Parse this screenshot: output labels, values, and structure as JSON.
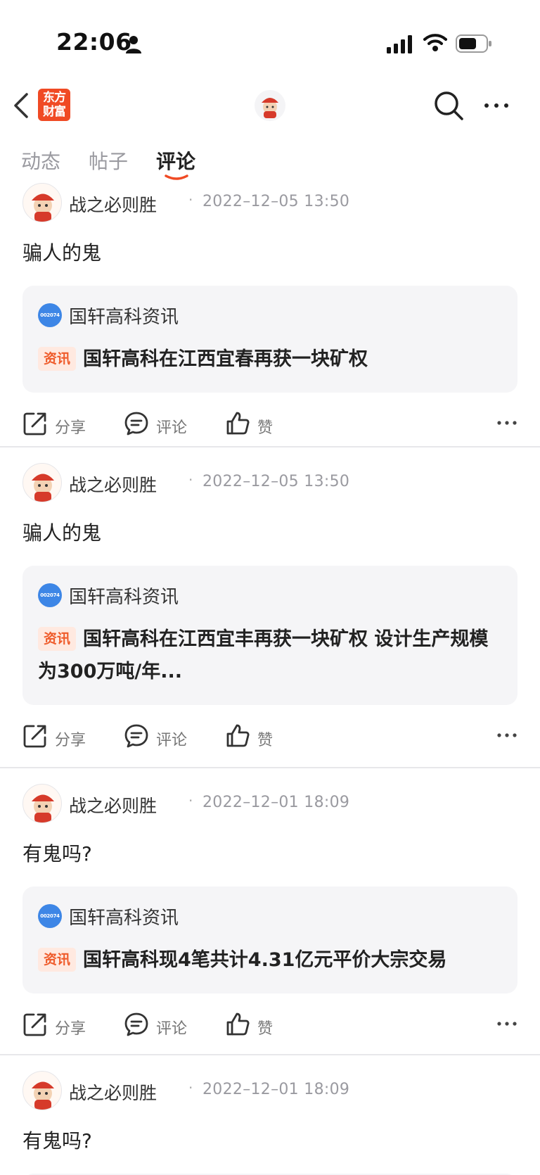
{
  "status_bar": {
    "time": "22:06"
  },
  "nav": {
    "logo_text_line1": "东方",
    "logo_text_line2": "财富"
  },
  "tabs": [
    {
      "label": "动态",
      "active": false
    },
    {
      "label": "帖子",
      "active": false
    },
    {
      "label": "评论",
      "active": true
    }
  ],
  "colors": {
    "accent": "#f04a24",
    "tag_bg": "#ffe9e0",
    "tag_text": "#ef5b2a",
    "stock_badge": "#3d86e6",
    "card_bg": "#f5f5f7"
  },
  "posts": [
    {
      "author": "战之必则胜",
      "time": "2022–12–05 13:50",
      "content": "骗人的鬼",
      "quote": {
        "stock_code": "002074",
        "source": "国轩高科资讯",
        "tag": "资讯",
        "title": "国轩高科在江西宜春再获一块矿权"
      },
      "actions": {
        "share": "分享",
        "comment": "评论",
        "like": "赞"
      }
    },
    {
      "author": "战之必则胜",
      "time": "2022–12–05 13:50",
      "content": "骗人的鬼",
      "quote": {
        "stock_code": "002074",
        "source": "国轩高科资讯",
        "tag": "资讯",
        "title": "国轩高科在江西宜丰再获一块矿权 设计生产规模为300万吨/年..."
      },
      "actions": {
        "share": "分享",
        "comment": "评论",
        "like": "赞"
      }
    },
    {
      "author": "战之必则胜",
      "time": "2022–12–01 18:09",
      "content": "有鬼吗?",
      "quote": {
        "stock_code": "002074",
        "source": "国轩高科资讯",
        "tag": "资讯",
        "title": "国轩高科现4笔共计4.31亿元平价大宗交易"
      },
      "actions": {
        "share": "分享",
        "comment": "评论",
        "like": "赞"
      }
    },
    {
      "author": "战之必则胜",
      "time": "2022–12–01 18:09",
      "content": "有鬼吗?"
    }
  ]
}
